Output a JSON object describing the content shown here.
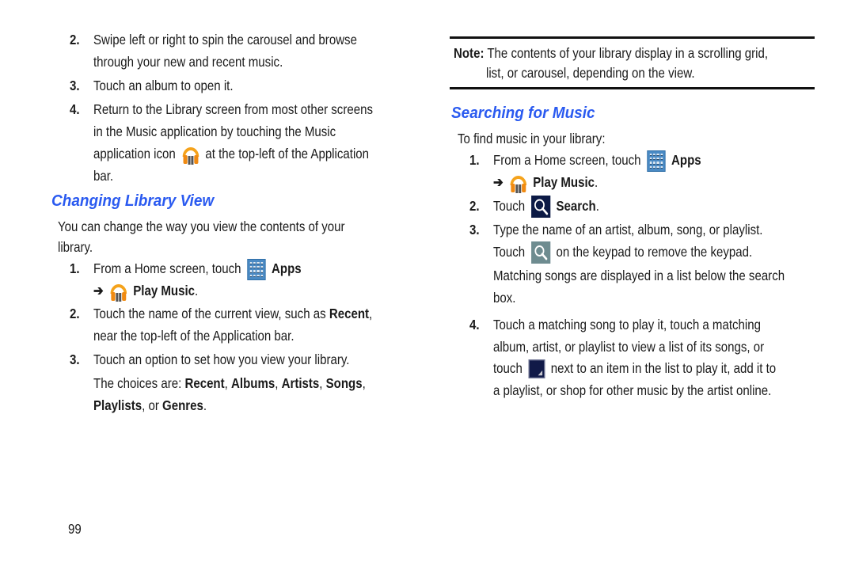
{
  "page_number": "99",
  "left": {
    "steps_top": [
      {
        "num": "2.",
        "lines": [
          "Swipe left or right to spin the carousel and browse",
          "through your new and recent music."
        ]
      },
      {
        "num": "3.",
        "lines": [
          "Touch an album to open it."
        ]
      },
      {
        "num": "4.",
        "lines": [
          "Return to the Library screen from most other screens",
          "in the Music application by touching the Music"
        ],
        "line3_pre": "application icon",
        "line3_post": "at the top-left of the Application",
        "line4": "bar."
      }
    ],
    "section_title": "Changing Library View",
    "intro_lines": [
      "You can change the way you view the contents of your",
      "library."
    ],
    "step1": {
      "num": "1.",
      "pre": "From a Home screen, touch",
      "apps": "Apps",
      "arrow": "➔",
      "play_music": "Play Music",
      "period": "."
    },
    "step2": {
      "num": "2.",
      "pre": "Touch the name of the current view, such as",
      "bold": "Recent",
      "post": ",",
      "line2": "near the top-left of the Application bar."
    },
    "step3": {
      "num": "3.",
      "line1": "Touch an option to set how you view your library.",
      "choices_pre": "The choices are:",
      "choices": [
        "Recent",
        "Albums",
        "Artists",
        "Songs",
        "Playlists",
        "Genres"
      ],
      "sep": ", ",
      "or": ", or ",
      "period": "."
    }
  },
  "right": {
    "note_label": "Note:",
    "note_lines": [
      "The contents of your library display in a scrolling grid,",
      "list, or carousel, depending on the view."
    ],
    "section_title": "Searching for Music",
    "intro": "To find music in your library:",
    "step1": {
      "num": "1.",
      "pre": "From a Home screen, touch",
      "apps": "Apps",
      "arrow": "➔",
      "play_music": "Play Music",
      "period": "."
    },
    "step2": {
      "num": "2.",
      "pre": "Touch",
      "bold": "Search",
      "period": "."
    },
    "step3": {
      "num": "3.",
      "line1": "Type the name of an artist, album, song, or playlist.",
      "line2_pre": "Touch",
      "line2_post": "on the keypad to remove the keypad.",
      "line3": "Matching songs are displayed in a list below the search",
      "line4": "box."
    },
    "step4": {
      "num": "4.",
      "line1": "Touch a matching song to play it, touch a matching",
      "line2": "album, artist, or playlist to view a list of its songs, or",
      "line3_pre": "touch",
      "line3_post": "next to an item in the list to play it, add it to",
      "line4": "a playlist, or shop for other music by the artist online."
    }
  },
  "colors": {
    "heading": "#2a5af0",
    "text": "#1a1a1a"
  }
}
